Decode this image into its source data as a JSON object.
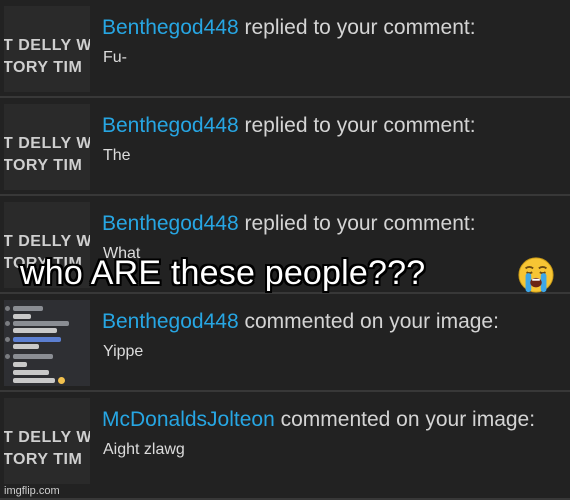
{
  "thumbnail": {
    "line1": "T DELLY W",
    "line2": "TORY TIM"
  },
  "notifications": [
    {
      "user": "Benthegod448",
      "action": " replied to your comment:",
      "message": "Fu-",
      "thumb": "text"
    },
    {
      "user": "Benthegod448",
      "action": " replied to your comment:",
      "message": "The",
      "thumb": "text"
    },
    {
      "user": "Benthegod448",
      "action": " replied to your comment:",
      "message": "What",
      "thumb": "text"
    },
    {
      "user": "Benthegod448",
      "action": " commented on your image:",
      "message": "Yippe",
      "thumb": "chat"
    },
    {
      "user": "McDonaldsJolteon",
      "action": " commented on your image:",
      "message": "Aight zlawg",
      "thumb": "text"
    }
  ],
  "caption": "who ARE these people???",
  "caption_emoji": "crying-face-emoji",
  "watermark": "imgflip.com",
  "colors": {
    "username": "#27a6e3",
    "text": "#d4d4d4",
    "background": "#222222"
  }
}
